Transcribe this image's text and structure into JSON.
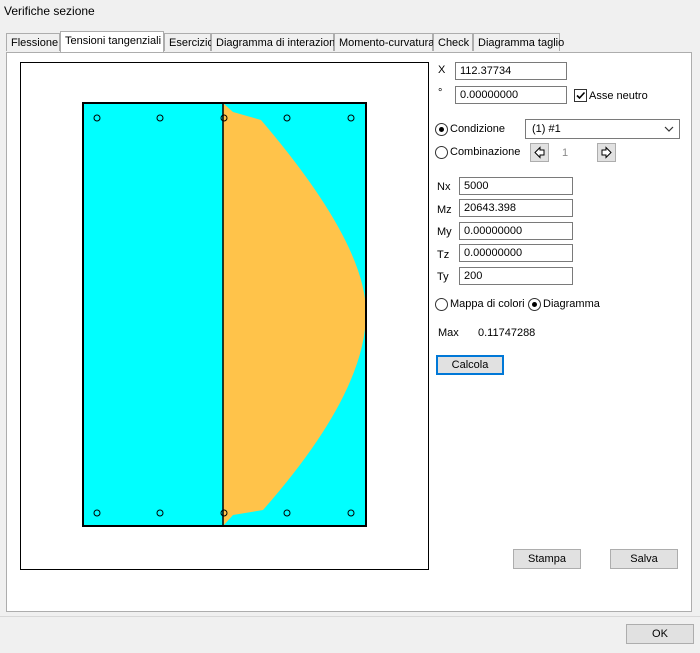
{
  "window": {
    "title": "Verifiche sezione"
  },
  "tabs": [
    {
      "label": "Flessione"
    },
    {
      "label": "Tensioni tangenziali"
    },
    {
      "label": "Esercizio"
    },
    {
      "label": "Diagramma di interazione"
    },
    {
      "label": "Momento-curvatura"
    },
    {
      "label": "Check"
    },
    {
      "label": "Diagramma taglio"
    }
  ],
  "coords": {
    "x_label": "X",
    "x_value": "112.37734",
    "angle_label": "°",
    "angle_value": "0.00000000",
    "asse_neutro_label": "Asse neutro",
    "asse_neutro_checked": true
  },
  "mode": {
    "condizione_label": "Condizione",
    "combinazione_label": "Combinazione",
    "selected": "condizione",
    "condizione_value": "(1) #1",
    "combinazione_index": "1"
  },
  "forces": [
    {
      "label": "Nx",
      "value": "5000"
    },
    {
      "label": "Mz",
      "value": "20643.398"
    },
    {
      "label": "My",
      "value": "0.00000000"
    },
    {
      "label": "Tz",
      "value": "0.00000000"
    },
    {
      "label": "Ty",
      "value": "200"
    }
  ],
  "display": {
    "mappa_label": "Mappa di colori",
    "diagramma_label": "Diagramma",
    "selected": "diagramma"
  },
  "max": {
    "label": "Max",
    "value": "0.11747288"
  },
  "buttons": {
    "calcola": "Calcola",
    "stampa": "Stampa",
    "salva": "Salva",
    "ok": "OK"
  },
  "colors": {
    "section_fill": "#00ffff",
    "stress_fill": "#ffc34a",
    "outline": "#000000"
  }
}
